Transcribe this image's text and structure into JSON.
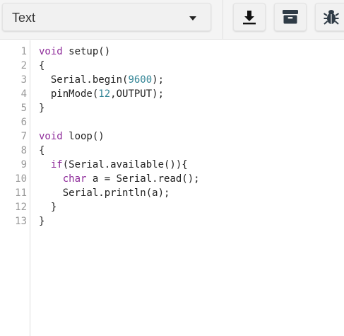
{
  "toolbar": {
    "mode_select": {
      "selected": "Text"
    },
    "buttons": [
      {
        "name": "download",
        "icon": "download-icon"
      },
      {
        "name": "archive",
        "icon": "archive-box-icon"
      },
      {
        "name": "debug",
        "icon": "bug-icon"
      }
    ]
  },
  "editor": {
    "line_numbers": [
      "1",
      "2",
      "3",
      "4",
      "5",
      "6",
      "7",
      "8",
      "9",
      "10",
      "11",
      "12",
      "13"
    ],
    "lines": [
      [
        {
          "t": "void",
          "c": "kw"
        },
        {
          "t": " setup()",
          "c": ""
        }
      ],
      [
        {
          "t": "{",
          "c": ""
        }
      ],
      [
        {
          "t": "  Serial.begin(",
          "c": ""
        },
        {
          "t": "9600",
          "c": "num"
        },
        {
          "t": ");",
          "c": ""
        }
      ],
      [
        {
          "t": "  pinMode(",
          "c": ""
        },
        {
          "t": "12",
          "c": "num"
        },
        {
          "t": ",OUTPUT);",
          "c": ""
        }
      ],
      [
        {
          "t": "}",
          "c": ""
        }
      ],
      [
        {
          "t": "",
          "c": ""
        }
      ],
      [
        {
          "t": "void",
          "c": "kw"
        },
        {
          "t": " loop()",
          "c": ""
        }
      ],
      [
        {
          "t": "{",
          "c": ""
        }
      ],
      [
        {
          "t": "  ",
          "c": ""
        },
        {
          "t": "if",
          "c": "kw"
        },
        {
          "t": "(Serial.available()){",
          "c": ""
        }
      ],
      [
        {
          "t": "    ",
          "c": ""
        },
        {
          "t": "char",
          "c": "kw"
        },
        {
          "t": " a = Serial.read();",
          "c": ""
        }
      ],
      [
        {
          "t": "    Serial.println(a);",
          "c": ""
        }
      ],
      [
        {
          "t": "  }",
          "c": ""
        }
      ],
      [
        {
          "t": "}",
          "c": ""
        }
      ]
    ]
  },
  "colors": {
    "keyword": "#8e2b9a",
    "number": "#318495",
    "text": "#222222",
    "line_number": "#999999"
  }
}
